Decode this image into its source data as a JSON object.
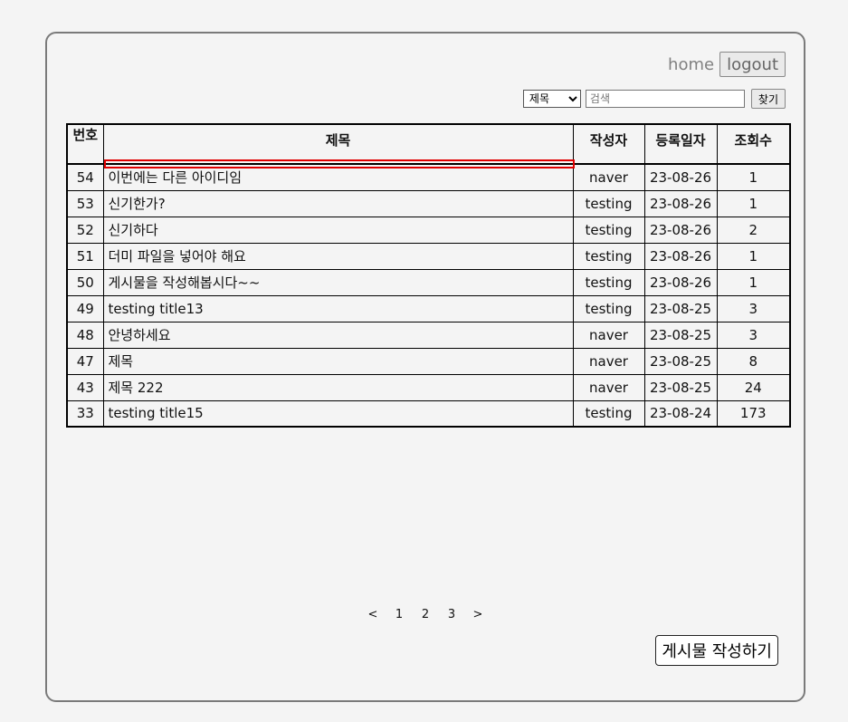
{
  "nav": {
    "home_label": "home",
    "logout_label": "logout"
  },
  "search": {
    "selected_option": "제목",
    "placeholder": "검색",
    "button_label": "찾기"
  },
  "table": {
    "headers": {
      "num": "번호",
      "title": "제목",
      "author": "작성자",
      "date": "등록일자",
      "views": "조회수"
    },
    "rows": [
      {
        "num": "54",
        "title": "이번에는 다른 아이디임",
        "author": "naver",
        "date": "23-08-26",
        "views": "1"
      },
      {
        "num": "53",
        "title": "신기한가?",
        "author": "testing",
        "date": "23-08-26",
        "views": "1"
      },
      {
        "num": "52",
        "title": "신기하다",
        "author": "testing",
        "date": "23-08-26",
        "views": "2"
      },
      {
        "num": "51",
        "title": "더미 파일을 넣어야 해요",
        "author": "testing",
        "date": "23-08-26",
        "views": "1"
      },
      {
        "num": "50",
        "title": "게시물을 작성해봅시다~~",
        "author": "testing",
        "date": "23-08-26",
        "views": "1"
      },
      {
        "num": "49",
        "title": "testing title13",
        "author": "testing",
        "date": "23-08-25",
        "views": "3"
      },
      {
        "num": "48",
        "title": "안녕하세요",
        "author": "naver",
        "date": "23-08-25",
        "views": "3"
      },
      {
        "num": "47",
        "title": "제목",
        "author": "naver",
        "date": "23-08-25",
        "views": "8"
      },
      {
        "num": "43",
        "title": "제목 222",
        "author": "naver",
        "date": "23-08-25",
        "views": "24"
      },
      {
        "num": "33",
        "title": "testing title15",
        "author": "testing",
        "date": "23-08-24",
        "views": "173"
      }
    ]
  },
  "pagination": {
    "prev": "<",
    "pages": [
      "1",
      "2",
      "3"
    ],
    "next": ">"
  },
  "write_button_label": "게시물 작성하기",
  "colors": {
    "highlight": "#e00000",
    "frame_border": "#7a7a7a",
    "background": "#f4f4f4"
  }
}
